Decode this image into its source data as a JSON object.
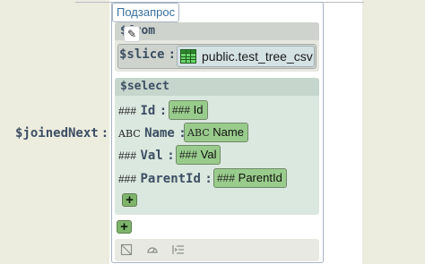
{
  "subquery": {
    "tab_label": "Подзапрос"
  },
  "joined_next": {
    "label": "$joinedNext",
    "colon": ":"
  },
  "from": {
    "header": "$from",
    "slice_label": "$slice",
    "slice_colon": ":",
    "slice_value": "public.test_tree_csv"
  },
  "select": {
    "header": "$select",
    "fields": [
      {
        "type_mark": "###",
        "name": "Id",
        "colon": ":",
        "value_type": "###",
        "value": "Id"
      },
      {
        "type_mark": "ABC",
        "name": "Name",
        "colon": ":",
        "value_type": "ABC",
        "value": "Name"
      },
      {
        "type_mark": "###",
        "name": "Val",
        "colon": ":",
        "value_type": "###",
        "value": "Val"
      },
      {
        "type_mark": "###",
        "name": "ParentId",
        "colon": ":",
        "value_type": "###",
        "value": "ParentId"
      }
    ],
    "add_field_symbol": "+"
  },
  "add_clause_symbol": "+",
  "toolbar": {
    "icons": [
      "crop-icon",
      "gauge-icon",
      "indent-icon"
    ]
  },
  "colors": {
    "chip_fill": "#99cc8c",
    "plus_fill": "#7fb56b",
    "label_text": "#3d4f63",
    "tab_text": "#37709f"
  }
}
